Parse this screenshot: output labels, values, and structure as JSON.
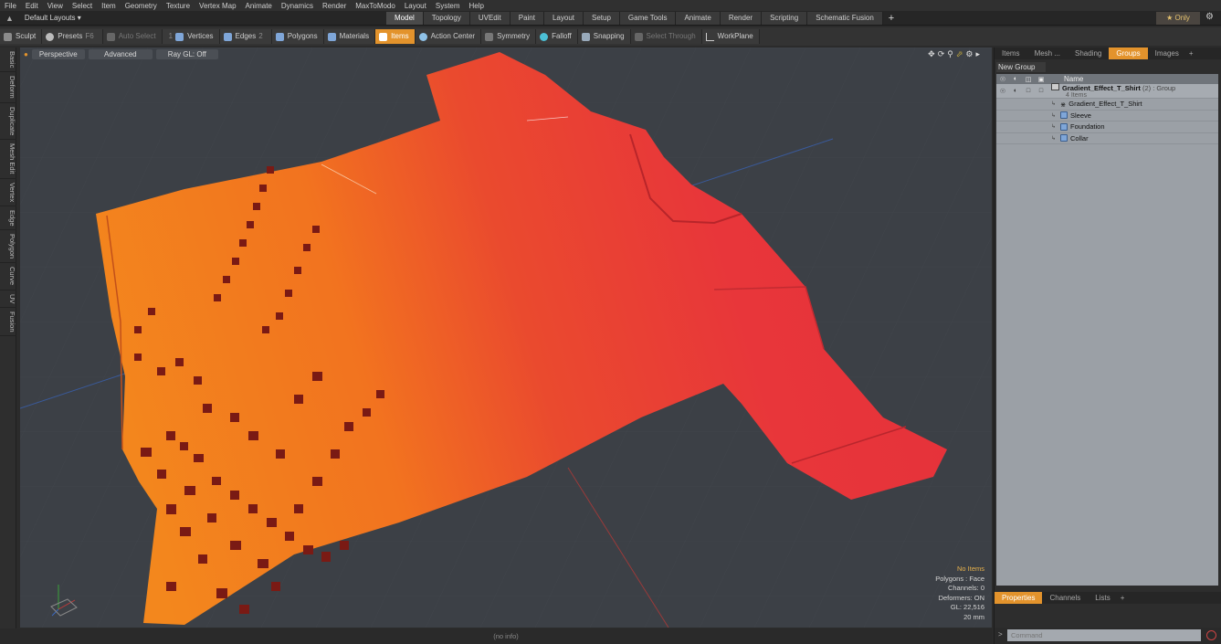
{
  "menubar": [
    "File",
    "Edit",
    "View",
    "Select",
    "Item",
    "Geometry",
    "Texture",
    "Vertex Map",
    "Animate",
    "Dynamics",
    "Render",
    "MaxToModo",
    "Layout",
    "System",
    "Help"
  ],
  "layout_selector": "Default Layouts ▾",
  "tabs": [
    "Model",
    "Topology",
    "UVEdit",
    "Paint",
    "Layout",
    "Setup",
    "Game Tools",
    "Animate",
    "Render",
    "Scripting",
    "Schematic Fusion"
  ],
  "active_tab": "Model",
  "only_button": "★ Only",
  "toolbar": {
    "sculpt": "Sculpt",
    "presets": "Presets",
    "presets_key": "F6",
    "auto_select": "Auto Select",
    "vertices": "Vertices",
    "vertices_num": "1",
    "edges": "Edges",
    "edges_num": "2",
    "polygons": "Polygons",
    "materials": "Materials",
    "items": "Items",
    "action_center": "Action Center",
    "symmetry": "Symmetry",
    "falloff": "Falloff",
    "snapping": "Snapping",
    "select_through": "Select Through",
    "workplane": "WorkPlane"
  },
  "left_strip": [
    "Basic",
    "Deform",
    "Duplicate",
    "Mesh Edit",
    "Vertex",
    "Edge",
    "Polygon",
    "Curve",
    "UV",
    "Fusion"
  ],
  "viewport": {
    "view_mode": "Perspective",
    "shading": "Advanced",
    "raygl": "Ray GL: Off",
    "info": {
      "no_items": "No Items",
      "polygons": "Polygons : Face",
      "channels": "Channels: 0",
      "deformers": "Deformers: ON",
      "gl": "GL: 22,516",
      "units": "20 mm"
    }
  },
  "status_text": "(no info)",
  "right_panel": {
    "tabs": [
      "Items",
      "Mesh ...",
      "Shading",
      "Groups",
      "Images"
    ],
    "active_tab": "Groups",
    "new_group": "New Group",
    "header_name": "Name",
    "group_name": "Gradient_Effect_T_Shirt",
    "group_count": "(2)",
    "group_type": ": Group",
    "group_items": "4 Items",
    "items": [
      "Gradient_Effect_T_Shirt",
      "Sleeve",
      "Foundation",
      "Collar"
    ],
    "bottom_tabs": [
      "Properties",
      "Channels",
      "Lists"
    ],
    "bottom_active": "Properties",
    "command_placeholder": "Command"
  },
  "colors": {
    "accent": "#e3932c",
    "shirt_red": "#e8343a",
    "shirt_orange": "#f07a1c"
  }
}
